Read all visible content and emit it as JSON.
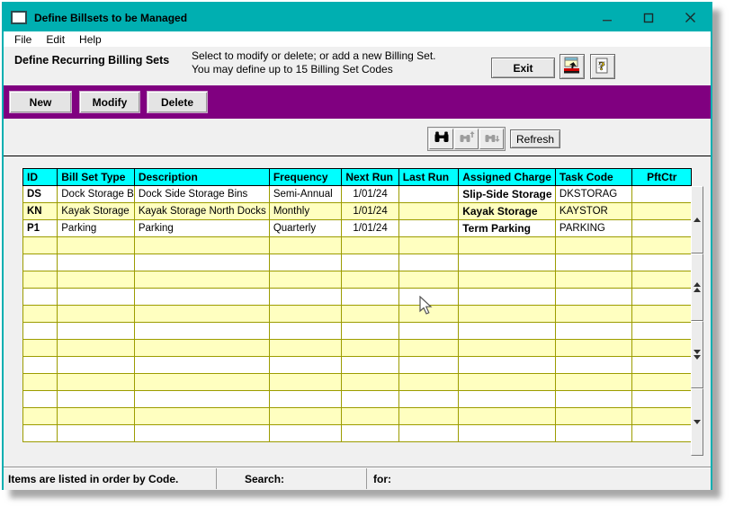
{
  "window": {
    "title": "Define Billsets to be Managed"
  },
  "menu": {
    "items": [
      "File",
      "Edit",
      "Help"
    ]
  },
  "header": {
    "title": "Define Recurring Billing Sets",
    "line1": "Select to modify or delete; or add a new Billing Set.",
    "line2": "You may define up to 15 Billing Set Codes",
    "exit_label": "Exit"
  },
  "toolbar": {
    "buttons": [
      "New",
      "Modify",
      "Delete"
    ],
    "refresh_label": "Refresh"
  },
  "table": {
    "columns": [
      "ID",
      "Bill Set Type",
      "Description",
      "Frequency",
      "Next Run",
      "Last Run",
      "Assigned Charge",
      "Task Code",
      "PftCtr"
    ],
    "rows": [
      [
        "DS",
        "Dock Storage Bin",
        "Dock Side Storage Bins",
        "Semi-Annual",
        "1/01/24",
        "",
        "Slip-Side Storage",
        "DKSTORAG",
        ""
      ],
      [
        "KN",
        "Kayak Storage",
        "Kayak Storage North Docks",
        "Monthly",
        "1/01/24",
        "",
        "Kayak Storage",
        "KAYSTOR",
        ""
      ],
      [
        "P1",
        "Parking",
        "Parking",
        "Quarterly",
        "1/01/24",
        "",
        "Term Parking",
        "PARKING",
        ""
      ]
    ],
    "empty_row_count": 12
  },
  "status": {
    "left": "Items are listed in order by Code.",
    "search_label": "Search:",
    "for_label": "for:"
  },
  "colors": {
    "titlebar": "#00AFB1",
    "accent_bar": "#800080",
    "header_bg": "#00FFFF",
    "row_alt": "#FFFFC0",
    "grid": "#9C9C00"
  }
}
